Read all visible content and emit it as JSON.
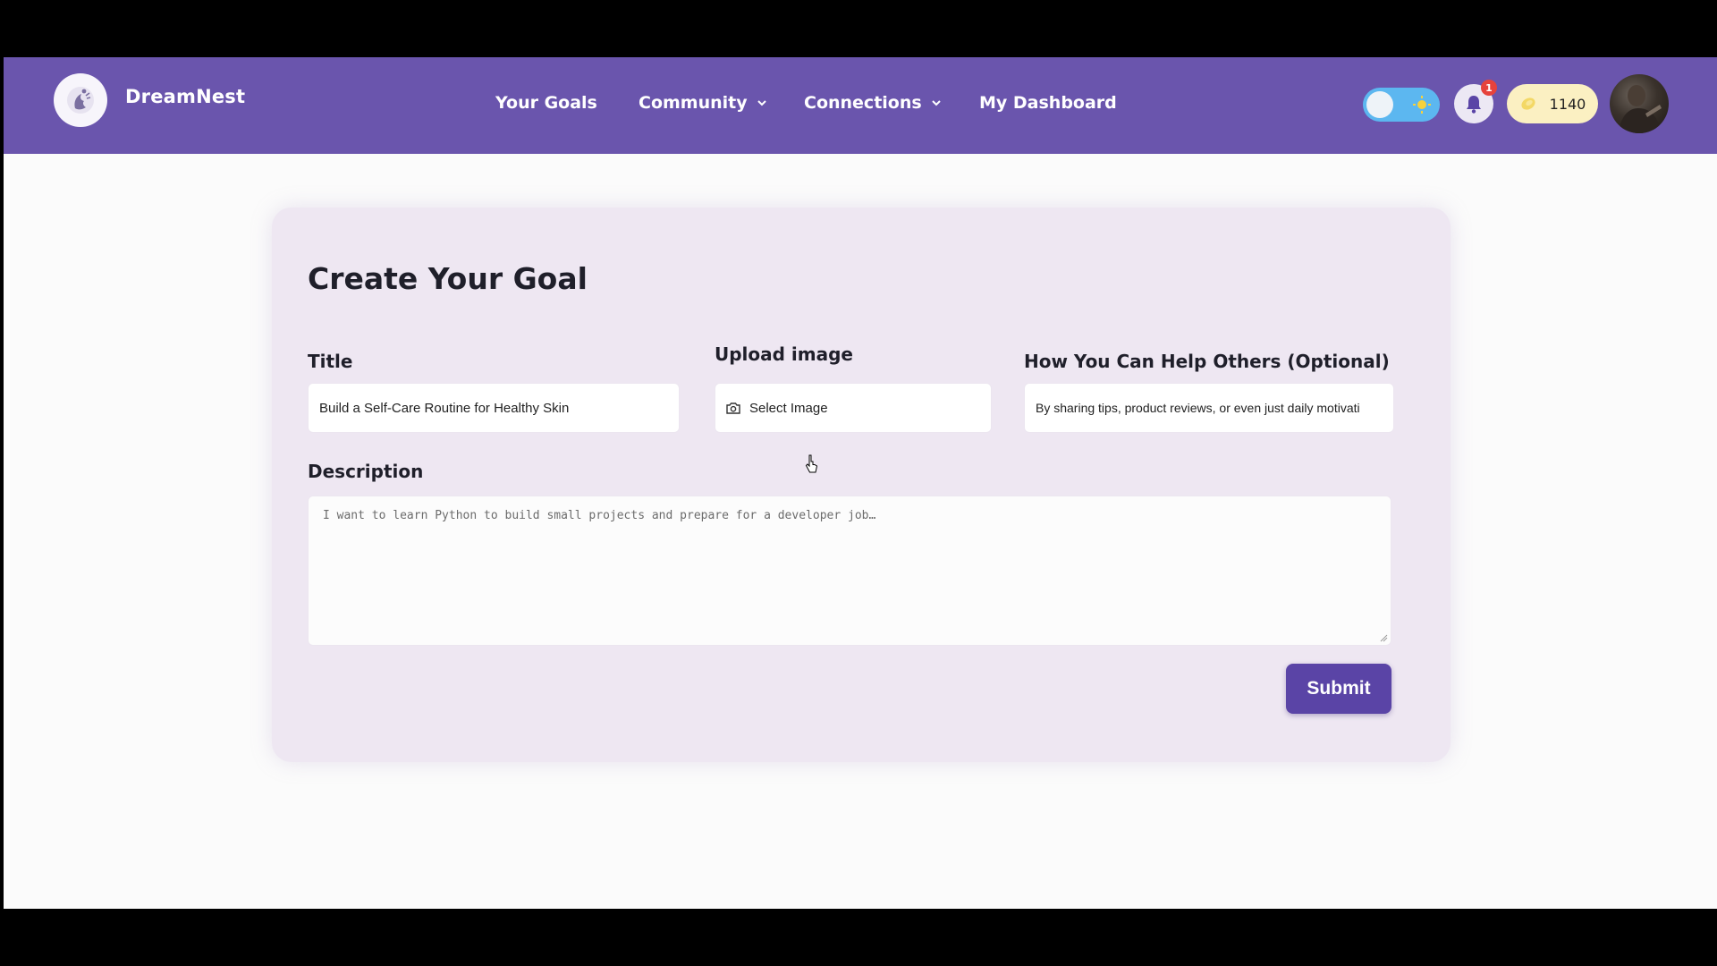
{
  "nav": {
    "brand": "DreamNest",
    "links": [
      "Your Goals",
      "Community",
      "Connections",
      "My Dashboard"
    ],
    "notification_count": "1",
    "coins": "1140"
  },
  "form": {
    "heading": "Create Your Goal",
    "title_label": "Title",
    "title_value": "Build a Self-Care Routine for Healthy Skin",
    "upload_label": "Upload image",
    "upload_button": "Select Image",
    "help_label": "How You Can Help Others (Optional)",
    "help_value": "By sharing tips, product reviews, or even just daily motivati",
    "description_label": "Description",
    "description_placeholder": "I want to learn Python to build small projects and prepare for a developer job…",
    "submit_label": "Submit"
  },
  "colors": {
    "nav_bg": "#6a55ad",
    "card_bg": "#eee7f2",
    "submit_bg": "#5a44a6",
    "badge": "#e6423c",
    "coins_bg": "#fbf0c2"
  },
  "icons": [
    "logo-icon",
    "chevron-down-icon",
    "sun-icon",
    "bell-icon",
    "coin-icon",
    "camera-icon",
    "cursor-icon"
  ]
}
